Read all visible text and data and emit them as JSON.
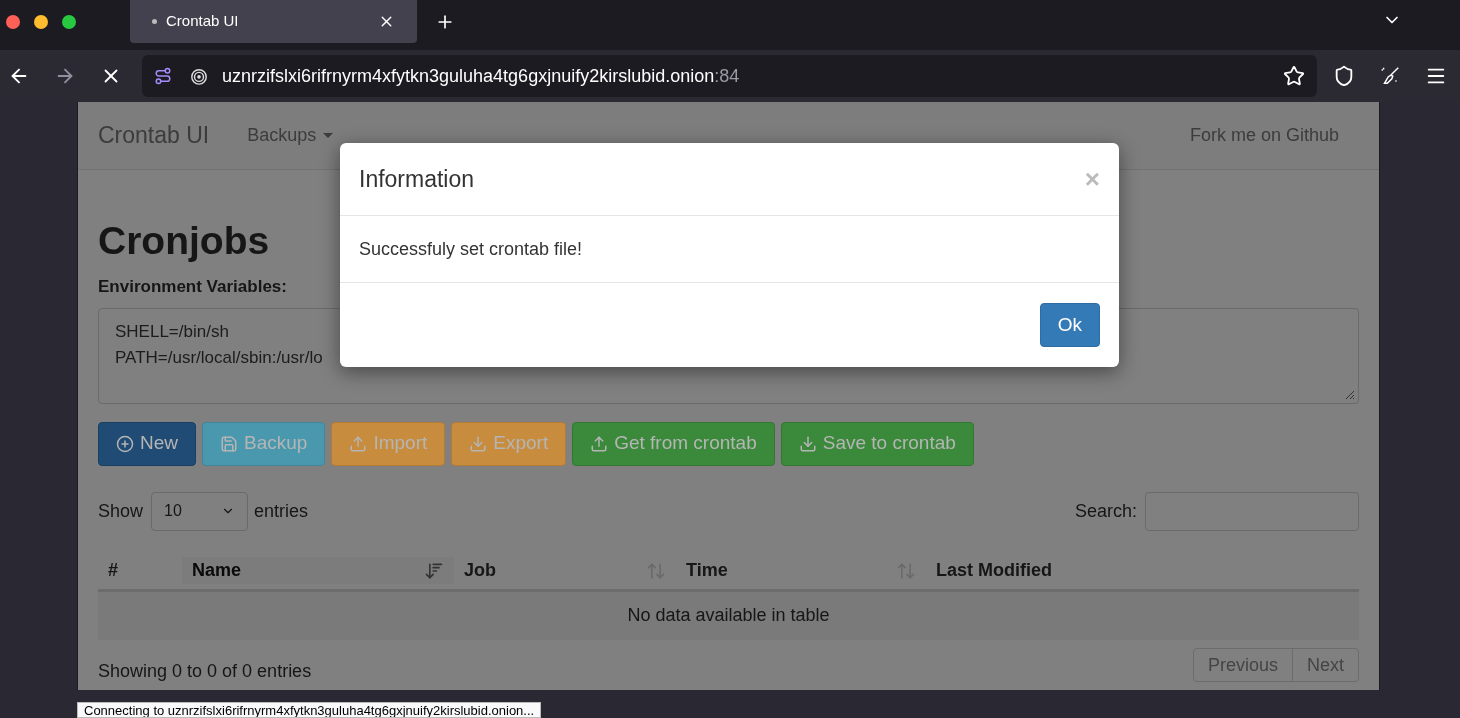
{
  "browser": {
    "tab": {
      "title": "Crontab UI",
      "loading": true
    },
    "url": {
      "host": "uznrzifslxi6rifrnyrm4xfytkn3guluha4tg6gxjnuify2kirslubid.onion",
      "port": ":84"
    }
  },
  "page": {
    "navbar": {
      "brand": "Crontab UI",
      "menu": "Backups",
      "link": "Fork me on Github"
    },
    "heading": "Cronjobs",
    "env_label": "Environment Variables:",
    "env_lines": [
      "SHELL=/bin/sh",
      "PATH=/usr/local/sbin:/usr/lo"
    ],
    "toolbar": [
      {
        "label": "New",
        "kind": "primary"
      },
      {
        "label": "Backup",
        "kind": "info"
      },
      {
        "label": "Import",
        "kind": "warning"
      },
      {
        "label": "Export",
        "kind": "warning"
      },
      {
        "label": "Get from crontab",
        "kind": "success"
      },
      {
        "label": "Save to crontab",
        "kind": "success"
      }
    ],
    "show_label": "Show",
    "page_size": "10",
    "entries_label": "entries",
    "search_label": "Search:",
    "table": {
      "columns": [
        {
          "label": "#",
          "sortable": false,
          "sorted": false
        },
        {
          "label": "Name",
          "sortable": true,
          "sorted": true
        },
        {
          "label": "Job",
          "sortable": true,
          "sorted": false
        },
        {
          "label": "Time",
          "sortable": true,
          "sorted": false
        },
        {
          "label": "Last Modified",
          "sortable": false,
          "sorted": false
        }
      ],
      "empty_message": "No data available in table"
    },
    "info": "Showing 0 to 0 of 0 entries",
    "pagination": [
      "Previous",
      "Next"
    ]
  },
  "modal": {
    "title": "Information",
    "close": "×",
    "body": "Successfuly set crontab file!",
    "ok": "Ok"
  },
  "status": "Connecting to uznrzifslxi6rifrnyrm4xfytkn3guluha4tg6gxjnuify2kirslubid.onion..."
}
